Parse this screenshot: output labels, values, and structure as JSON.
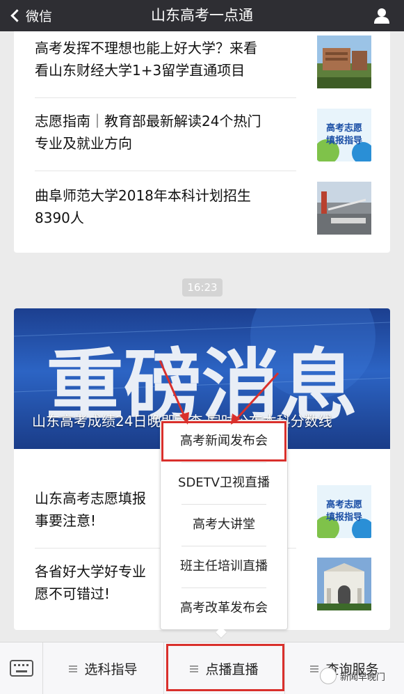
{
  "header": {
    "back_label": "微信",
    "title": "山东高考一点通"
  },
  "articles": [
    {
      "title_line1": "高考发挥不理想也能上好大学？来看",
      "title_line2": "看山东财经大学1+3留学直通项目",
      "thumb": "campus-building-photo"
    },
    {
      "title_line1": "志愿指南｜教育部最新解读24个热门",
      "title_line2": "专业及就业方向",
      "thumb": "gaokao-zhiyuan-poster"
    },
    {
      "title_line1": "曲阜师范大学2018年本科计划招生",
      "title_line2": "8390人",
      "thumb": "qufu-normal-univ-gate"
    }
  ],
  "timestamp": "16:23",
  "feature": {
    "banner_text": "重磅消息",
    "caption": "山东高考成绩24日晚即可查 同时公布本科分数线"
  },
  "articles2": [
    {
      "title_line1": "山东高考志愿填报",
      "title_line2": "事要注意!",
      "thumb": "gaokao-zhiyuan-poster"
    },
    {
      "title_line1": "各省好大学好专业",
      "title_line2": "愿不可错过!",
      "thumb": "tsinghua-gate-photo"
    }
  ],
  "thumb_text": {
    "zhiyuan_line1": "高考志愿",
    "zhiyuan_line2": "填报指导"
  },
  "popup_menu": {
    "items": [
      "高考新闻发布会",
      "SDETV卫视直播",
      "高考大讲堂",
      "班主任培训直播",
      "高考改革发布会"
    ]
  },
  "bottom_menu": {
    "items": [
      "选科指导",
      "点播直播",
      "查询服务"
    ]
  },
  "watermark": "新闻早晚门",
  "colors": {
    "header_bg": "#2e2e33",
    "highlight_red": "#d9302c",
    "banner_blue": "#2c64c4"
  }
}
